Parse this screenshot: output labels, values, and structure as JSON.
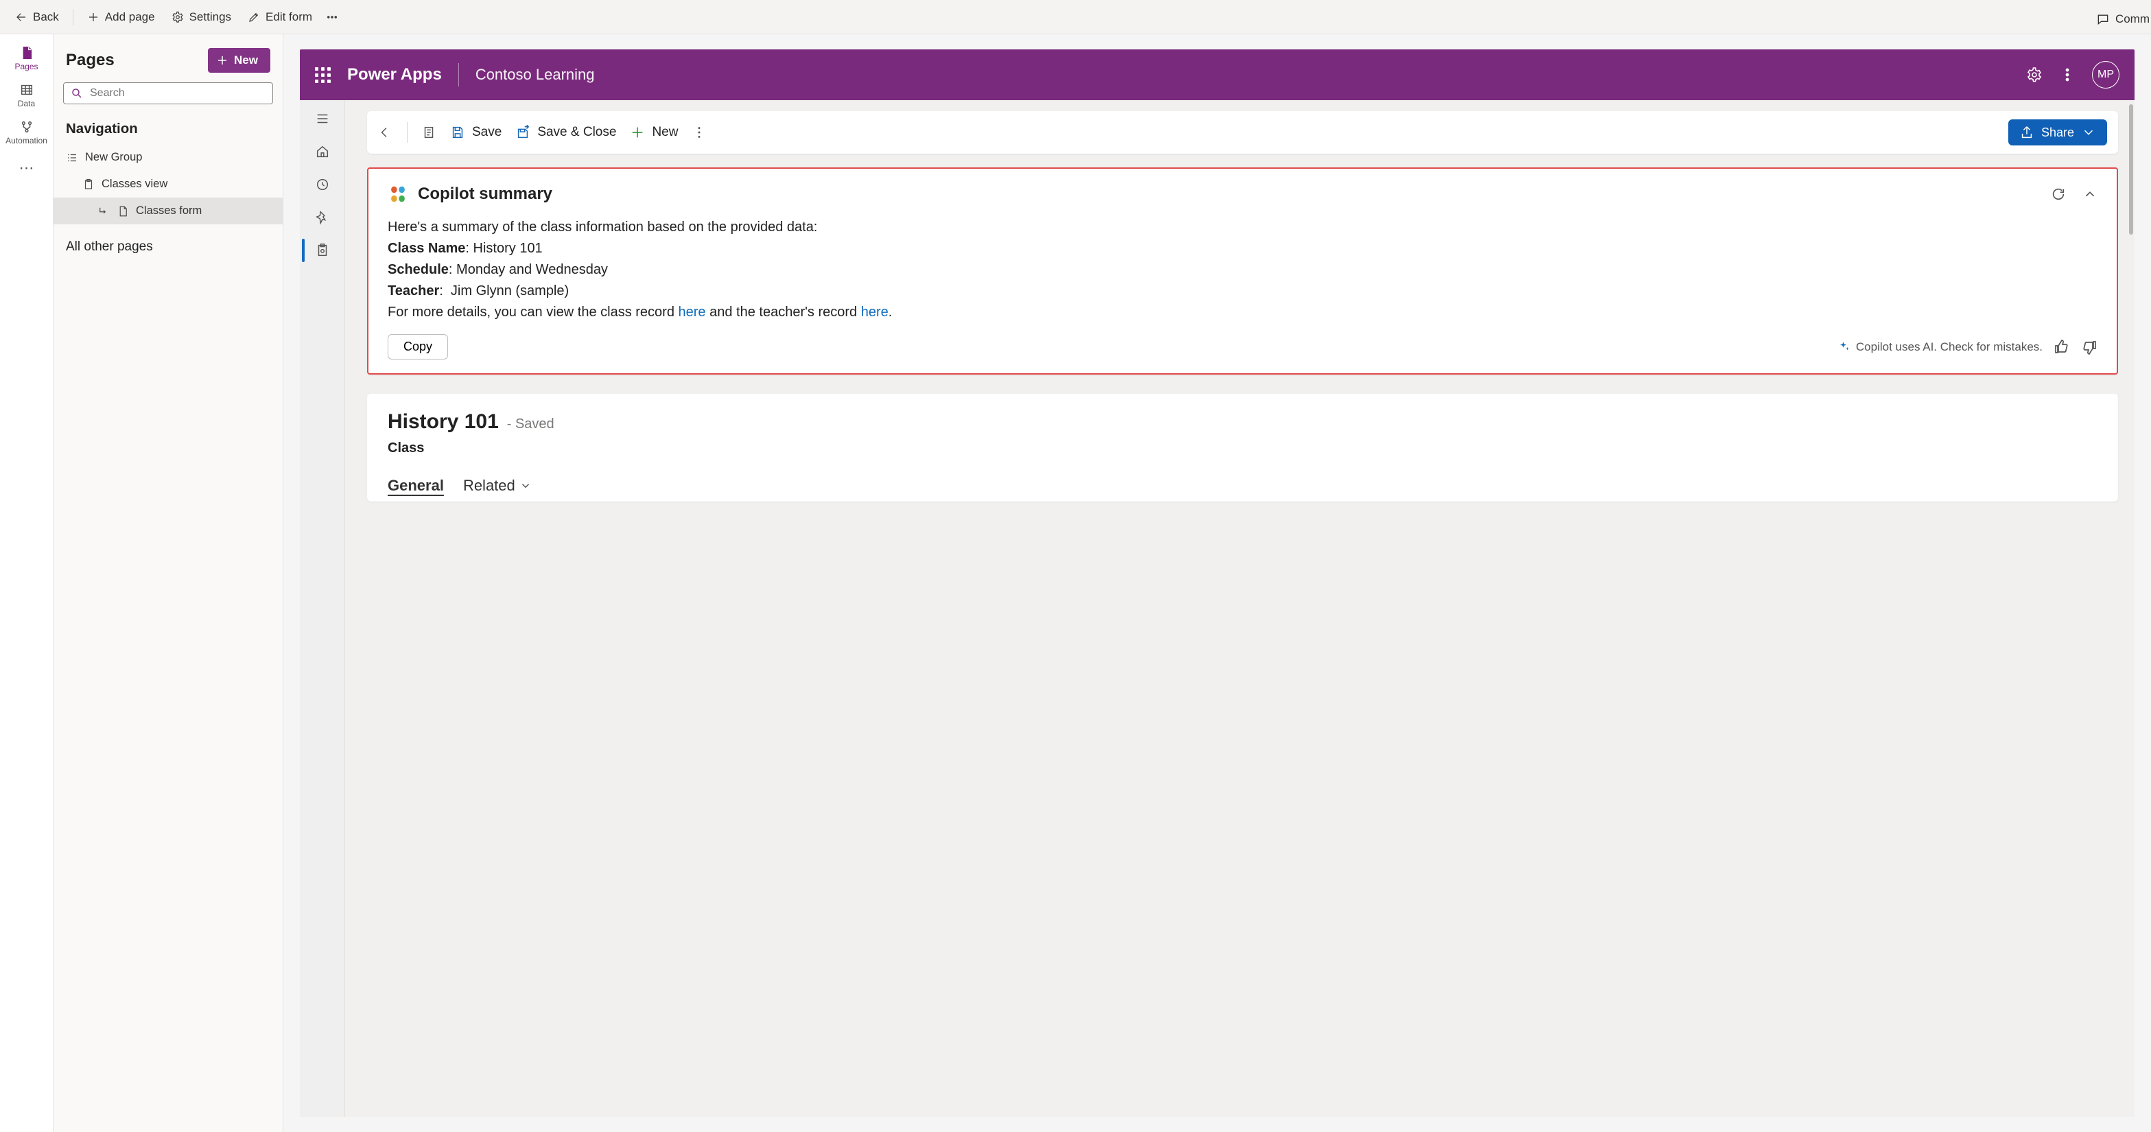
{
  "topbar": {
    "back": "Back",
    "add_page": "Add page",
    "settings": "Settings",
    "edit_form": "Edit form",
    "comments": "Comm"
  },
  "left_rail": {
    "pages": "Pages",
    "data": "Data",
    "automation": "Automation"
  },
  "pages_panel": {
    "title": "Pages",
    "new": "New",
    "search_placeholder": "Search",
    "navigation": "Navigation",
    "new_group": "New Group",
    "classes_view": "Classes view",
    "classes_form": "Classes form",
    "all_other": "All other pages"
  },
  "app_header": {
    "brand": "Power Apps",
    "env": "Contoso Learning",
    "avatar": "MP"
  },
  "form_cmdbar": {
    "save": "Save",
    "save_close": "Save & Close",
    "new": "New",
    "share": "Share"
  },
  "copilot": {
    "title": "Copilot summary",
    "intro": "Here's a summary of the class information based on the provided data:",
    "class_name_label": "Class Name",
    "class_name_value": "History 101",
    "schedule_label": "Schedule",
    "schedule_value": "Monday and Wednesday",
    "teacher_label": "Teacher",
    "teacher_value": "Jim Glynn (sample)",
    "more_pre": "For more details, you can view the class record ",
    "link1": "here",
    "more_mid": " and the teacher's record ",
    "link2": "here",
    "copy": "Copy",
    "ai_note": "Copilot uses AI. Check for mistakes."
  },
  "record": {
    "title": "History 101",
    "saved": "- Saved",
    "entity": "Class",
    "tab_general": "General",
    "tab_related": "Related"
  }
}
